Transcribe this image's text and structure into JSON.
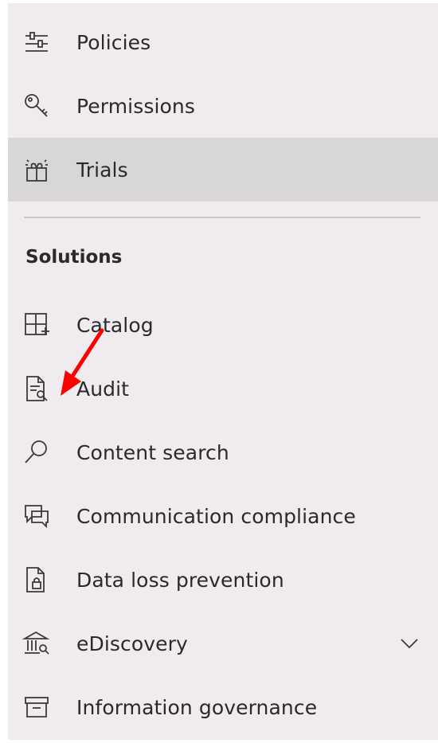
{
  "nav": {
    "items": [
      {
        "label": "Policies",
        "icon": "policies-sliders-icon"
      },
      {
        "label": "Permissions",
        "icon": "key-icon"
      },
      {
        "label": "Trials",
        "icon": "gift-trials-icon",
        "selected": true
      }
    ]
  },
  "solutions": {
    "header": "Solutions",
    "items": [
      {
        "label": "Catalog",
        "icon": "catalog-grid-plus-icon"
      },
      {
        "label": "Audit",
        "icon": "audit-document-search-icon"
      },
      {
        "label": "Content search",
        "icon": "search-icon"
      },
      {
        "label": "Communication compliance",
        "icon": "chat-bubbles-icon"
      },
      {
        "label": "Data loss prevention",
        "icon": "document-lock-icon"
      },
      {
        "label": "eDiscovery",
        "icon": "ediscovery-bank-icon",
        "expandable": true
      },
      {
        "label": "Information governance",
        "icon": "archive-box-icon"
      }
    ]
  },
  "colors": {
    "panel_background": "#efebef",
    "selected_background": "#d9d6d9",
    "annotation_arrow": "#ff0000"
  }
}
